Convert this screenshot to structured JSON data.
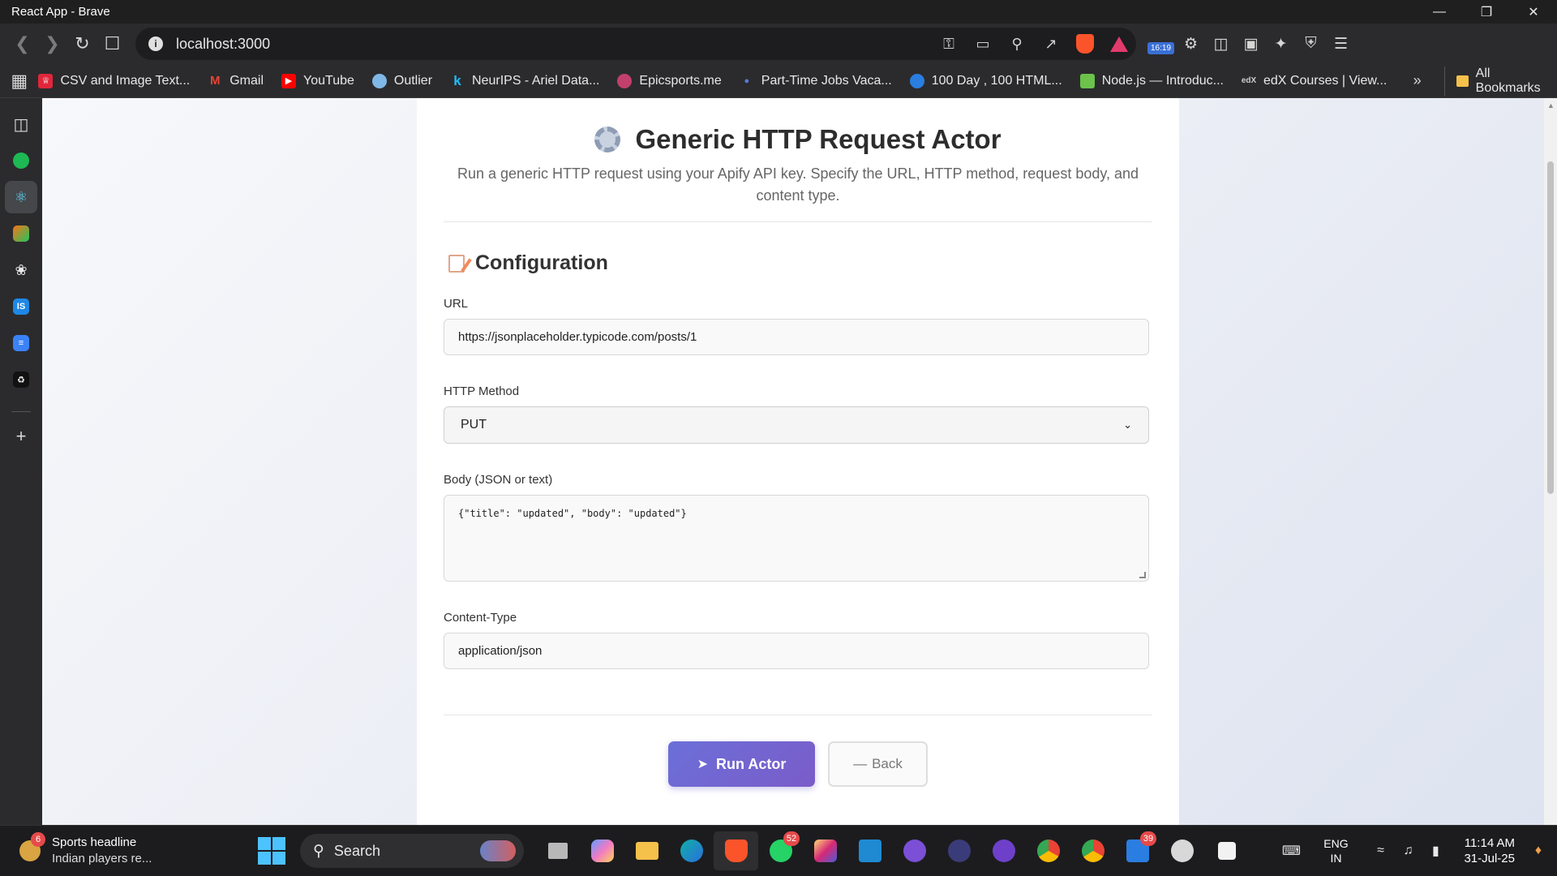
{
  "window": {
    "title": "React App - Brave"
  },
  "browser": {
    "url": "localhost:3000",
    "toolbar_badge": "16:19",
    "bookmarks": [
      {
        "label": "CSV and Image Text...",
        "icon": "crown-icon",
        "color": "#e0263b"
      },
      {
        "label": "Gmail",
        "icon": "gmail-icon",
        "color": "#ea4335"
      },
      {
        "label": "YouTube",
        "icon": "youtube-icon",
        "color": "#ff0000"
      },
      {
        "label": "Outlier",
        "icon": "outlier-icon",
        "color": "#7fb8e6"
      },
      {
        "label": "NeurIPS - Ariel Data...",
        "icon": "kaggle-icon",
        "color": "#20beff"
      },
      {
        "label": "Epicsports.me",
        "icon": "epicsports-icon",
        "color": "#c2406b"
      },
      {
        "label": "Part-Time Jobs Vaca...",
        "icon": "jobs-icon",
        "color": "#5a7bd8"
      },
      {
        "label": "100 Day , 100 HTML...",
        "icon": "html-icon",
        "color": "#2a7de1"
      },
      {
        "label": "Node.js — Introduc...",
        "icon": "nodejs-icon",
        "color": "#6cc24a"
      },
      {
        "label": "edX Courses | View...",
        "icon": "edx-icon",
        "color": "#3a3a3a"
      }
    ],
    "bookmarks_folder": "All Bookmarks"
  },
  "page": {
    "title": "Generic HTTP Request Actor",
    "subtitle": "Run a generic HTTP request using your Apify API key. Specify the URL, HTTP method, request body, and content type.",
    "section_title": "Configuration",
    "fields": {
      "url": {
        "label": "URL",
        "value": "https://jsonplaceholder.typicode.com/posts/1"
      },
      "method": {
        "label": "HTTP Method",
        "value": "PUT"
      },
      "body": {
        "label": "Body (JSON or text)",
        "value": "{\"title\": \"updated\", \"body\": \"updated\"}"
      },
      "content_type": {
        "label": "Content-Type",
        "value": "application/json"
      }
    },
    "buttons": {
      "run": "Run Actor",
      "back": "Back"
    }
  },
  "taskbar": {
    "news_title": "Sports headline",
    "news_sub": "Indian players re...",
    "news_badge": "6",
    "search_label": "Search",
    "whatsapp_badge": "52",
    "app_badge": "39",
    "lang_top": "ENG",
    "lang_bottom": "IN",
    "time": "11:14 AM",
    "date": "31-Jul-25"
  },
  "colors": {
    "accent_gradient_start": "#6b6fd8",
    "accent_gradient_end": "#7b5cc9",
    "brave_orange": "#fb542b"
  }
}
